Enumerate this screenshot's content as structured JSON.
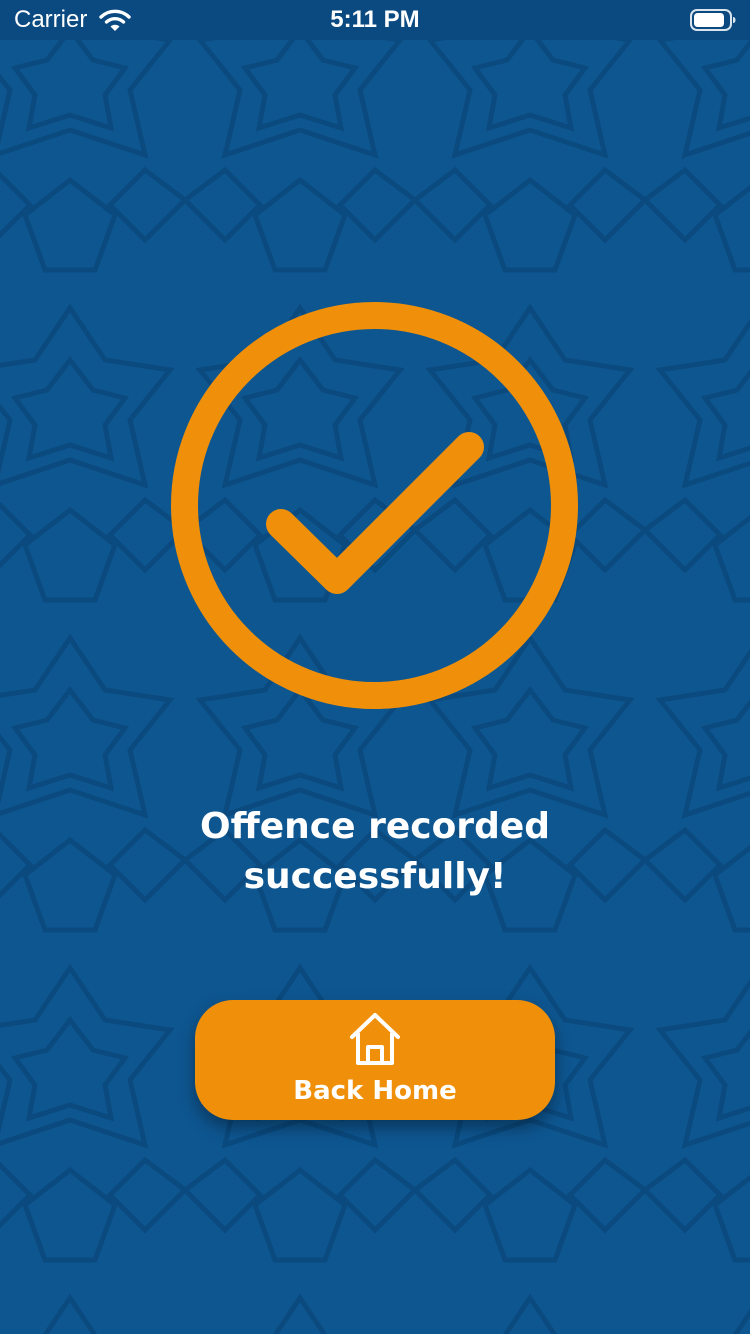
{
  "status_bar": {
    "carrier": "Carrier",
    "time": "5:11 PM",
    "icons": [
      "wifi-icon",
      "battery-icon"
    ]
  },
  "main": {
    "status_icon": "check-circle-icon",
    "message_line1": "Offence recorded",
    "message_line2": "successfully!",
    "back_home_label": "Back Home",
    "back_home_icon": "home-icon"
  },
  "colors": {
    "background": "#0e5690",
    "status_bar": "#0b4a80",
    "accent": "#f0900a",
    "text": "#ffffff"
  }
}
